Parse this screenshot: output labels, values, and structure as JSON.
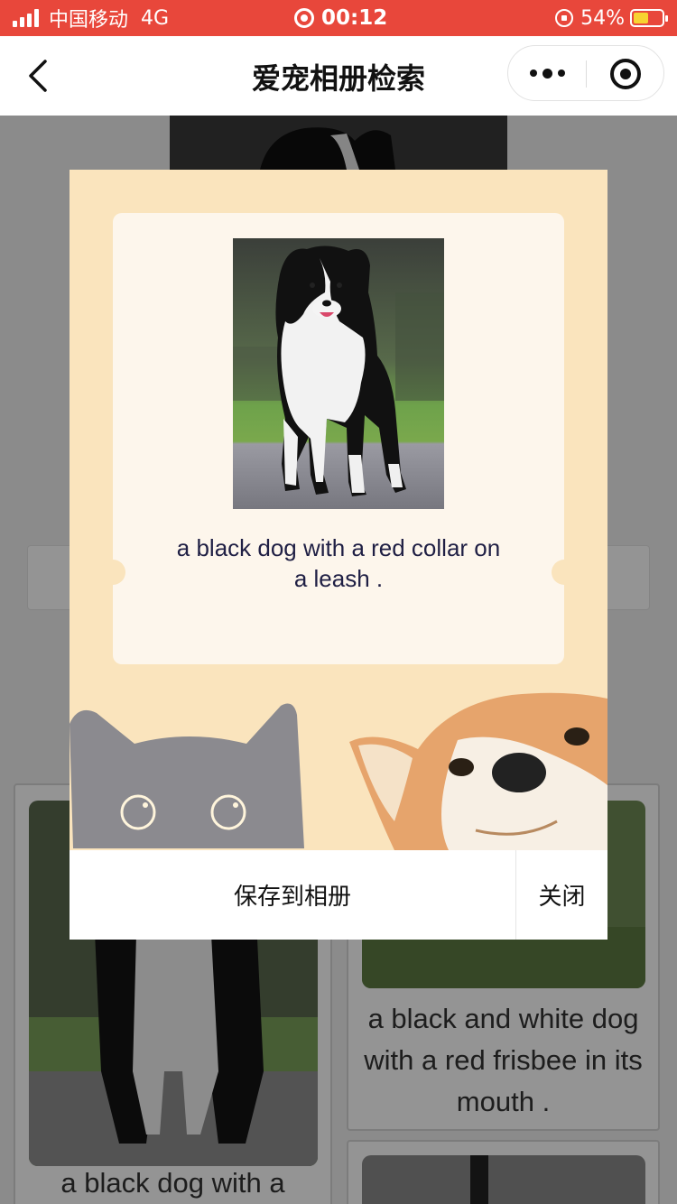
{
  "status_bar": {
    "carrier": "中国移动",
    "network": "4G",
    "time": "00:12",
    "battery": "54%",
    "battery_level": 0.54
  },
  "nav": {
    "title": "爱宠相册检索",
    "back_icon": "chevron-left-icon",
    "more_icon": "more-dots-icon",
    "close_icon": "target-circle-icon"
  },
  "modal": {
    "caption": "a black dog with a red collar on a leash .",
    "save_label": "保存到相册",
    "close_label": "关闭"
  },
  "background_cards": [
    {
      "caption": "a black dog with a"
    },
    {
      "caption": "a black and white dog with a red frisbee in its mouth ."
    }
  ],
  "colors": {
    "status_bar": "#e8473b",
    "modal_bg": "#fae4bd",
    "ticket_bg": "#fdf6ec",
    "caption_text": "#1f1f44"
  }
}
